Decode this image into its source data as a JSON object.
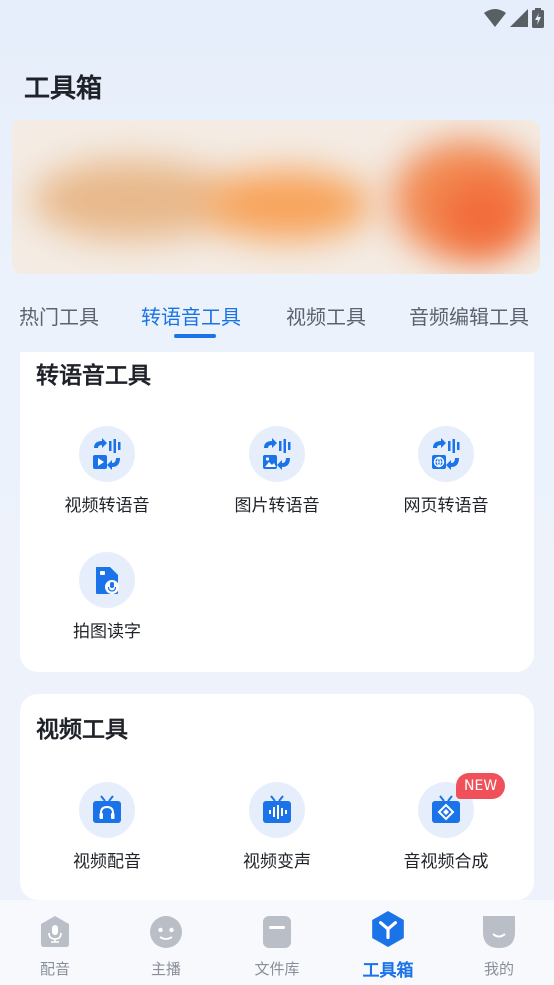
{
  "page": {
    "title": "工具箱"
  },
  "tabs": [
    {
      "label": "热门工具",
      "active": false
    },
    {
      "label": "转语音工具",
      "active": true
    },
    {
      "label": "视频工具",
      "active": false
    },
    {
      "label": "音频编辑工具",
      "active": false
    }
  ],
  "sections": [
    {
      "title": "转语音工具",
      "tools": [
        {
          "label": "视频转语音",
          "icon": "video-to-speech-icon"
        },
        {
          "label": "图片转语音",
          "icon": "image-to-speech-icon"
        },
        {
          "label": "网页转语音",
          "icon": "webpage-to-speech-icon"
        },
        {
          "label": "拍图读字",
          "icon": "photo-read-text-icon"
        }
      ]
    },
    {
      "title": "视频工具",
      "tools": [
        {
          "label": "视频配音",
          "icon": "video-dubbing-icon"
        },
        {
          "label": "视频变声",
          "icon": "video-voice-change-icon"
        },
        {
          "label": "音视频合成",
          "icon": "av-merge-icon",
          "badge": "NEW"
        }
      ]
    }
  ],
  "bottom_nav": [
    {
      "label": "配音",
      "icon": "dubbing-icon",
      "active": false
    },
    {
      "label": "主播",
      "icon": "anchor-icon",
      "active": false
    },
    {
      "label": "文件库",
      "icon": "file-library-icon",
      "active": false
    },
    {
      "label": "工具箱",
      "icon": "toolbox-icon",
      "active": true
    },
    {
      "label": "我的",
      "icon": "profile-icon",
      "active": false
    }
  ],
  "colors": {
    "accent": "#1a73e8",
    "badge": "#f0505a",
    "icon_bg": "#e7eefb"
  }
}
